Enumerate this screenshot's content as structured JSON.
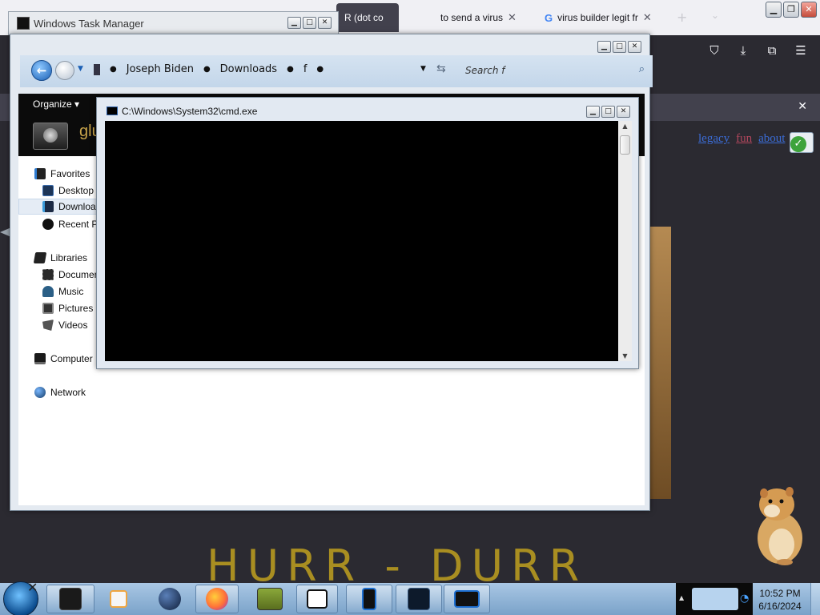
{
  "firefox": {
    "tabs": [
      {
        "label": "R (dot co",
        "active": true
      },
      {
        "label": "to send a virus",
        "active": false
      },
      {
        "label": "virus builder legit fr",
        "active": false
      }
    ],
    "links": [
      "legacy",
      "fun",
      "about"
    ],
    "banner_text": "HURR - DURR"
  },
  "task_manager": {
    "title": "Windows Task Manager"
  },
  "explorer": {
    "breadcrumbs": [
      "Joseph Biden",
      "Downloads",
      "f"
    ],
    "search_placeholder": "Search f",
    "organize_label": "Organize",
    "folder_name": "glu",
    "nav_items": [
      {
        "label": "Favorites",
        "icon": "favorites-icon"
      },
      {
        "label": "Desktop",
        "icon": "desktop-icon"
      },
      {
        "label": "Downloa",
        "icon": "downloads-icon",
        "selected": true
      },
      {
        "label": "Recent P",
        "icon": "recent-places-icon"
      },
      {
        "label": "Libraries",
        "icon": "libraries-icon"
      },
      {
        "label": "Documer",
        "icon": "documents-icon"
      },
      {
        "label": "Music",
        "icon": "music-icon"
      },
      {
        "label": "Pictures",
        "icon": "pictures-icon"
      },
      {
        "label": "Videos",
        "icon": "videos-icon"
      },
      {
        "label": "Computer",
        "icon": "computer-icon"
      },
      {
        "label": "Network",
        "icon": "network-icon"
      }
    ]
  },
  "cmd": {
    "title": "C:\\Windows\\System32\\cmd.exe"
  },
  "taskbar": {
    "pinned": [
      {
        "name": "black-box-app",
        "color": "#1a1a1a"
      },
      {
        "name": "media-player",
        "color": "#f0a640"
      },
      {
        "name": "globe-app",
        "color": "#1e3a66"
      },
      {
        "name": "firefox",
        "color": "#ff7139"
      },
      {
        "name": "cat-box-app",
        "color": "#6d8c2a"
      },
      {
        "name": "7zip",
        "color": "#ffffff"
      },
      {
        "name": "tablet-app",
        "color": "#1e6fd0"
      },
      {
        "name": "task-manager",
        "color": "#0d1a2b"
      },
      {
        "name": "cmd-window",
        "color": "#1e6fd0"
      }
    ],
    "clock_time": "10:52 PM",
    "clock_date": "6/16/2024"
  },
  "colors": {
    "firefox_dark": "#2b2a31",
    "banner_gold": "#a98e21",
    "aero_blue": "#a9c7e4"
  }
}
